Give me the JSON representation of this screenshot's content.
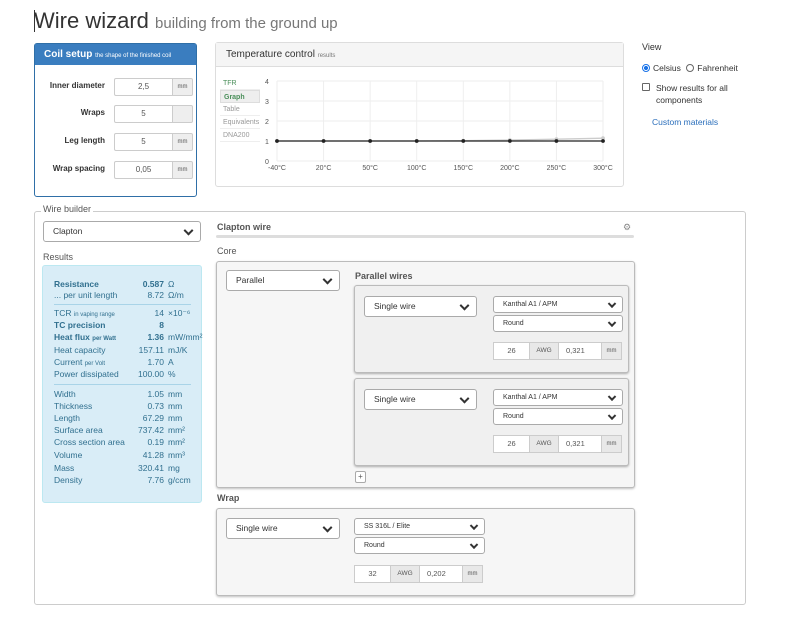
{
  "header": {
    "title": "Wire wizard",
    "subtitle": "building from the ground up"
  },
  "coil": {
    "title": "Coil setup",
    "title_note": "the shape of the finished coil",
    "fields": [
      {
        "label": "Inner diameter",
        "value": "2,5",
        "unit": "mm"
      },
      {
        "label": "Wraps",
        "value": "5",
        "unit": ""
      },
      {
        "label": "Leg length",
        "value": "5",
        "unit": "mm"
      },
      {
        "label": "Wrap spacing",
        "value": "0,05",
        "unit": "mm"
      }
    ]
  },
  "temp": {
    "title": "Temperature control",
    "title_note": "results",
    "tabs": [
      "TFR",
      "Graph",
      "Table",
      "Equivalents",
      "DNA200"
    ],
    "active_tab": "Graph"
  },
  "chart_data": {
    "type": "line",
    "x": [
      "-40°C",
      "20°C",
      "50°C",
      "100°C",
      "150°C",
      "200°C",
      "250°C",
      "300°C"
    ],
    "series": [
      {
        "values": [
          1,
          1,
          1,
          1,
          1,
          1,
          1,
          1
        ],
        "color": "#222222"
      },
      {
        "values": [
          1,
          1,
          1,
          1,
          1.02,
          1.05,
          1.09,
          1.14
        ],
        "color": "#cccccc"
      }
    ],
    "yticks": [
      "0",
      "1",
      "2",
      "3",
      "4"
    ],
    "ylim": [
      0,
      4
    ],
    "grid": true
  },
  "view": {
    "title": "View",
    "celsius": "Celsius",
    "fahrenheit": "Fahrenheit",
    "show_all": "Show results for all components",
    "custom_link": "Custom materials"
  },
  "builder": {
    "legend": "Wire builder",
    "type_select": "Clapton",
    "results_label": "Results",
    "results_main": [
      {
        "k": "Resistance",
        "note": "",
        "v": "0.587",
        "u": "Ω",
        "bold": true
      },
      {
        "k": "... per unit length",
        "note": "",
        "v": "8.72",
        "u": "Ω/m",
        "bold": false
      },
      {
        "k": "TCR",
        "note": "in vaping range",
        "v": "14",
        "u": "×10⁻⁶",
        "bold": false
      },
      {
        "k": "TC precision",
        "note": "",
        "v": "8",
        "u": "",
        "bold": true
      },
      {
        "k": "Heat flux",
        "note": "per Watt",
        "v": "1.36",
        "u": "mW/mm²",
        "bold": true
      },
      {
        "k": "Heat capacity",
        "note": "",
        "v": "157.11",
        "u": "mJ/K",
        "bold": false
      },
      {
        "k": "Current",
        "note": "per Volt",
        "v": "1.70",
        "u": "A",
        "bold": false
      },
      {
        "k": "Power dissipated",
        "note": "",
        "v": "100.00",
        "u": "%",
        "bold": false
      }
    ],
    "results_dims": [
      {
        "k": "Width",
        "v": "1.05",
        "u": "mm"
      },
      {
        "k": "Thickness",
        "v": "0.73",
        "u": "mm"
      },
      {
        "k": "Length",
        "v": "67.29",
        "u": "mm"
      },
      {
        "k": "Surface area",
        "v": "737.42",
        "u": "mm²"
      },
      {
        "k": "Cross section area",
        "v": "0.19",
        "u": "mm²"
      },
      {
        "k": "Volume",
        "v": "41.28",
        "u": "mm³"
      },
      {
        "k": "Mass",
        "v": "320.41",
        "u": "mg"
      },
      {
        "k": "Density",
        "v": "7.76",
        "u": "g/ccm"
      }
    ],
    "clapton_label": "Clapton wire",
    "core_label": "Core",
    "core_select": "Parallel",
    "parallel_label": "Parallel wires",
    "wires": [
      {
        "type": "Single wire",
        "material": "Kanthal A1 / APM",
        "shape": "Round",
        "gauge": "26",
        "awg": "AWG",
        "diameter": "0,321",
        "unit": "mm"
      },
      {
        "type": "Single wire",
        "material": "Kanthal A1 / APM",
        "shape": "Round",
        "gauge": "26",
        "awg": "AWG",
        "diameter": "0,321",
        "unit": "mm"
      }
    ],
    "plus": "+",
    "wrap_label": "Wrap",
    "wrap": {
      "type": "Single wire",
      "material": "SS 316L / Elite",
      "shape": "Round",
      "gauge": "32",
      "awg": "AWG",
      "diameter": "0,202",
      "unit": "mm"
    }
  }
}
